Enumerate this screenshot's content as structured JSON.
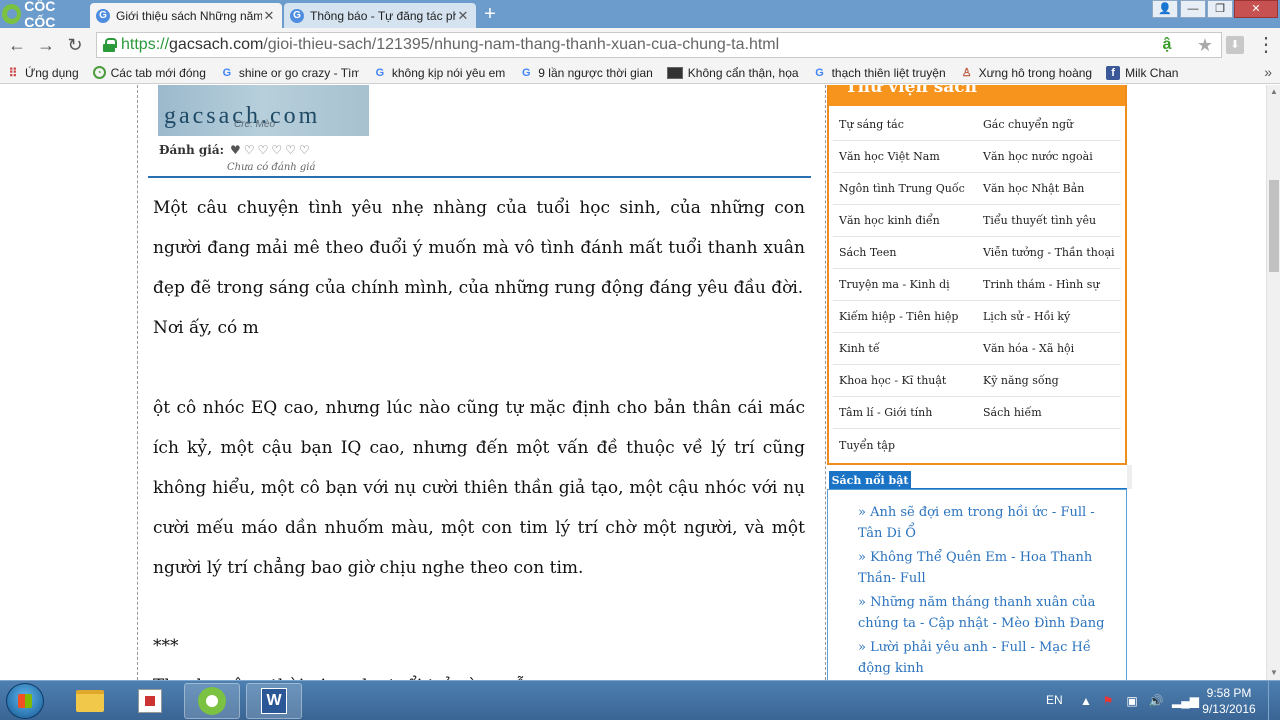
{
  "browser": {
    "brand": "CỐC CỐC",
    "tabs": [
      {
        "title": "Giới thiệu sách Những năm tháng thanh xuân của chúng ta",
        "active": true
      },
      {
        "title": "Thông báo - Tự đăng tác phẩm",
        "active": false
      }
    ],
    "new_tab": "+",
    "url_scheme": "https://",
    "url_host": "gacsach.com",
    "url_path": "/gioi-thieu-sach/121395/nhung-nam-thang-thanh-xuan-cua-chung-ta.html"
  },
  "bookmarks": [
    {
      "label": "Ứng dụng",
      "icon": "apps-icon"
    },
    {
      "label": "Các tab mới đóng",
      "icon": "history-icon"
    },
    {
      "label": "shine or go crazy - Tìm",
      "icon": "google-icon"
    },
    {
      "label": "không kịp nói yêu em",
      "icon": "google-icon"
    },
    {
      "label": "9 lần ngược thời gian",
      "icon": "google-icon"
    },
    {
      "label": "Không cẩn thận, họa",
      "icon": "image-icon"
    },
    {
      "label": "thạch thiên liệt truyện",
      "icon": "google-icon"
    },
    {
      "label": "Xưng hô trong hoàng",
      "icon": "person-icon"
    },
    {
      "label": "Milk Chan",
      "icon": "facebook-icon"
    }
  ],
  "book": {
    "cover_text": "gacsach.com",
    "cover_sign": "Cre: Mèo",
    "rating_label": "Đánh giá:",
    "hearts": "♥♡♡♡♡♡",
    "rating_note": "Chưa có đánh giá"
  },
  "article": {
    "p1": "Một câu chuyện tình yêu nhẹ nhàng của tuổi học sinh, của những con người đang mải mê theo đuổi ý muốn mà vô tình đánh mất tuổi thanh xuân đẹp đẽ trong sáng của chính mình, của những rung động đáng yêu đầu đời.",
    "p2": "Nơi ấy, có m",
    "p3": "ột cô nhóc EQ cao, nhưng lúc nào cũng tự mặc định cho bản thân cái mác ích kỷ, một cậu bạn IQ cao, nhưng đến một vấn đề thuộc về lý trí cũng không hiểu, một cô bạn với nụ cười thiên thần giả tạo, một cậu nhóc với nụ cười mếu máo dần nhuốm màu, một con tim lý trí chờ một người, và một người lý trí chẳng bao giờ chịu nghe theo con tim.",
    "sep": "***",
    "p4": "Thanh xuân - thời gian cho tuổi trẻ vùng vẫy."
  },
  "library": {
    "title": "Thư viện sách",
    "rows": [
      [
        "Tự sáng tác",
        "Gác chuyển ngữ"
      ],
      [
        "Văn học Việt Nam",
        "Văn học nước ngoài"
      ],
      [
        "Ngôn tình Trung Quốc",
        "Văn học Nhật Bản"
      ],
      [
        "Văn học kinh điển",
        "Tiểu thuyết tình yêu"
      ],
      [
        "Sách Teen",
        "Viễn tưởng - Thần thoại"
      ],
      [
        "Truyện ma - Kinh dị",
        "Trinh thám - Hình sự"
      ],
      [
        "Kiếm hiệp - Tiên hiệp",
        "Lịch sử - Hồi ký"
      ],
      [
        "Kinh tế",
        "Văn hóa - Xã hội"
      ],
      [
        "Khoa học - Kĩ thuật",
        "Kỹ năng sống"
      ],
      [
        "Tâm lí - Giới tính",
        "Sách hiếm"
      ],
      [
        "Tuyển tập",
        ""
      ]
    ]
  },
  "featured": {
    "title": "Sách nổi bật",
    "items": [
      "» Anh sẽ đợi em trong hồi ức - Full - Tân Di Ổ",
      "» Không Thể Quên Em - Hoa Thanh Thần- Full",
      "» Những năm tháng thanh xuân của chúng ta - Cập nhật - Mèo Đình Đang",
      "» Lười phải yêu anh - Full - Mạc Hề động kinh"
    ]
  },
  "taskbar": {
    "lang": "EN",
    "time": "9:58 PM",
    "date": "9/13/2016"
  }
}
